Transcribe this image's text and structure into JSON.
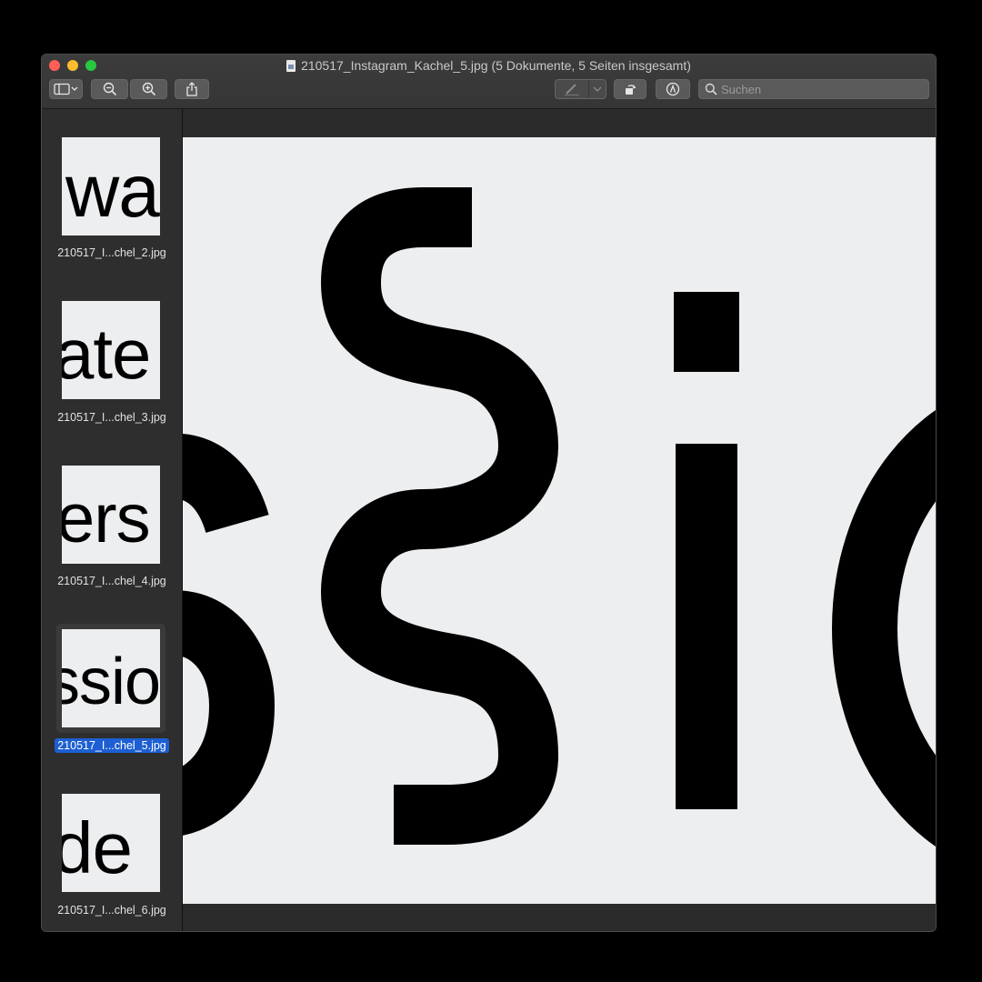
{
  "window": {
    "title": "210517_Instagram_Kachel_5.jpg (5 Dokumente, 5 Seiten insgesamt)"
  },
  "toolbar": {
    "sidebar_toggle_icon": "sidebar-icon",
    "zoom_out_icon": "zoom-out-icon",
    "zoom_in_icon": "zoom-in-icon",
    "share_icon": "share-icon",
    "markup_pen_icon": "pen-icon",
    "rotate_icon": "rotate-icon",
    "markup_icon": "markup-icon",
    "search_placeholder": "Suchen"
  },
  "sidebar": {
    "items": [
      {
        "label": "210517_I...chel_2.jpg",
        "preview_text": "wa",
        "selected": false
      },
      {
        "label": "210517_I...chel_3.jpg",
        "preview_text": "ate",
        "selected": false
      },
      {
        "label": "210517_I...chel_4.jpg",
        "preview_text": "ers",
        "selected": false
      },
      {
        "label": "210517_I...chel_5.jpg",
        "preview_text": "ssio",
        "selected": true
      },
      {
        "label": "210517_I...chel_6.jpg",
        "preview_text": "de",
        "selected": false
      }
    ]
  },
  "colors": {
    "selection": "#1d5fd3",
    "page_background": "#eceef0",
    "glyph": "#000000"
  }
}
